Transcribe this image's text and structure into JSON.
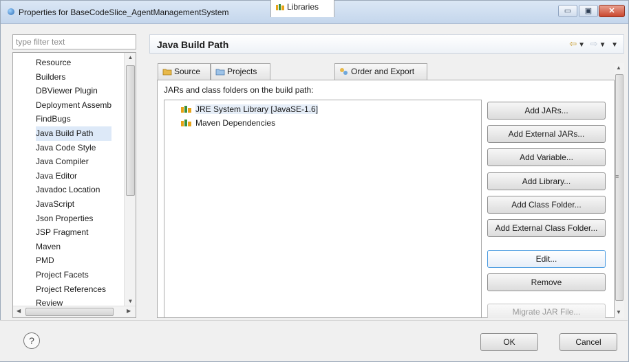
{
  "window": {
    "title": "Properties for BaseCodeSlice_AgentManagementSystem",
    "min_glyph": "▭",
    "max_glyph": "▣",
    "close_glyph": "✕"
  },
  "filter": {
    "placeholder": "type filter text"
  },
  "tree": {
    "items": [
      {
        "label": "Resource"
      },
      {
        "label": "Builders"
      },
      {
        "label": "DBViewer Plugin"
      },
      {
        "label": "Deployment Assemb"
      },
      {
        "label": "FindBugs"
      },
      {
        "label": "Java Build Path",
        "selected": true
      },
      {
        "label": "Java Code Style"
      },
      {
        "label": "Java Compiler"
      },
      {
        "label": "Java Editor"
      },
      {
        "label": "Javadoc Location"
      },
      {
        "label": "JavaScript"
      },
      {
        "label": "Json Properties"
      },
      {
        "label": "JSP Fragment"
      },
      {
        "label": "Maven"
      },
      {
        "label": "PMD"
      },
      {
        "label": "Project Facets"
      },
      {
        "label": "Project References"
      },
      {
        "label": "Review"
      }
    ],
    "scroll_up": "▲",
    "scroll_down": "▼",
    "scroll_left": "◀",
    "scroll_right": "▶",
    "hgrip": "III",
    "vgrip": "≡"
  },
  "page": {
    "title": "Java Build Path",
    "nav_back": "⇦",
    "nav_forward": "⇨",
    "nav_menu": "▼"
  },
  "tabs": [
    {
      "label": "Source",
      "icon": "source-folder-icon"
    },
    {
      "label": "Projects",
      "icon": "projects-icon"
    },
    {
      "label": "Libraries",
      "icon": "libraries-icon",
      "active": true
    },
    {
      "label": "Order and Export",
      "icon": "order-export-icon"
    }
  ],
  "libraries": {
    "section_label": "JARs and class folders on the build path:",
    "items": [
      {
        "label": "JRE System Library [JavaSE-1.6]",
        "selected": true
      },
      {
        "label": "Maven Dependencies"
      }
    ]
  },
  "buttons": {
    "add_jars": "Add JARs...",
    "add_external_jars": "Add External JARs...",
    "add_variable": "Add Variable...",
    "add_library": "Add Library...",
    "add_class_folder": "Add Class Folder...",
    "add_external_class_folder": "Add External Class Folder...",
    "edit": "Edit...",
    "remove": "Remove",
    "migrate_jar": "Migrate JAR File..."
  },
  "footer": {
    "help": "?",
    "ok": "OK",
    "cancel": "Cancel"
  },
  "colors": {
    "accent": "#4a9be0",
    "selection": "#dde9f8",
    "library_icon_orange": "#e8a317",
    "library_icon_green": "#3a8f3a"
  }
}
